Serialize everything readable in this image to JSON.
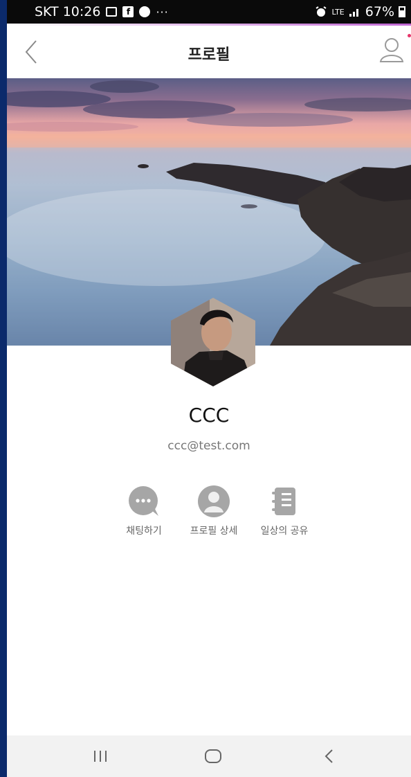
{
  "status_bar": {
    "carrier_time": "SKT 10:26",
    "fb_label": "f",
    "more": "···",
    "network": "LTE",
    "battery": "67%"
  },
  "header": {
    "title": "프로필"
  },
  "profile": {
    "name": "CCC",
    "email": "ccc@test.com"
  },
  "actions": [
    {
      "label": "채팅하기",
      "icon": "chat-bubble-icon"
    },
    {
      "label": "프로필 상세",
      "icon": "person-icon"
    },
    {
      "label": "일상의 공유",
      "icon": "notebook-icon"
    }
  ],
  "colors": {
    "accent": "#c066d3",
    "icon_gray": "#a6a6a6"
  }
}
